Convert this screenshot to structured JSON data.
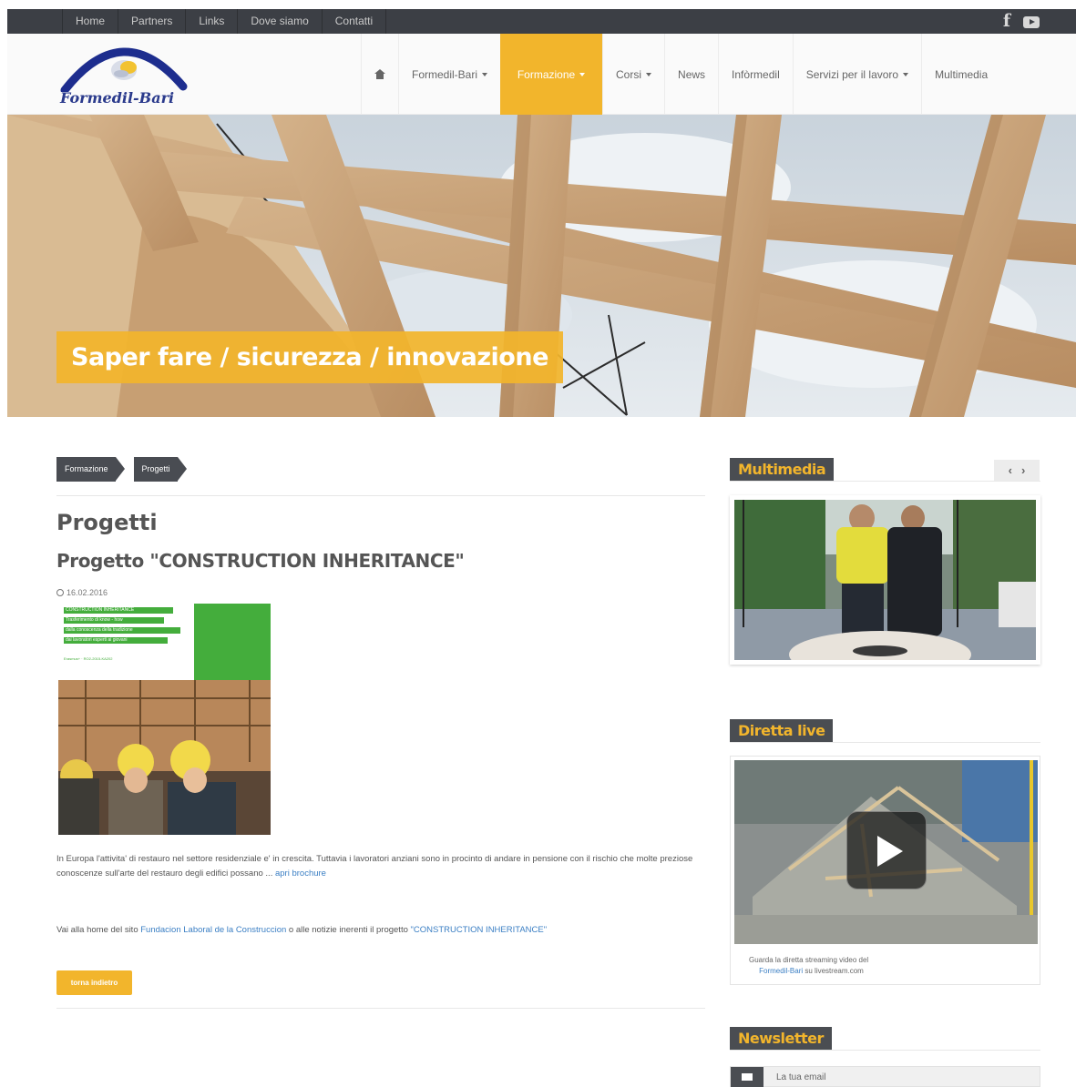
{
  "topbar": {
    "links": [
      "Home",
      "Partners",
      "Links",
      "Dove siamo",
      "Contatti"
    ],
    "social": {
      "facebook": "f",
      "youtube_icon": "youtube-icon"
    }
  },
  "header": {
    "logo_text": "Formedil-Bari",
    "nav": [
      "Formedil-Bari",
      "Formazione",
      "Corsi",
      "News",
      "Infòrmedil",
      "Servizi per il lavoro",
      "Multimedia"
    ],
    "active_nav": "Formazione"
  },
  "hero": {
    "caption": "Saper fare / sicurezza / innovazione"
  },
  "breadcrumb": [
    "Formazione",
    "Progetti"
  ],
  "main": {
    "page_title": "Progetti",
    "article_title": "Progetto \"CONSTRUCTION INHERITANCE\"",
    "date": "16.02.2016",
    "brochure": {
      "line1": "CONSTRUCTION INHERITANCE",
      "line2": "Trasferimento di know - how",
      "line3": "dalla conoscenza della tradizione",
      "line4": "dai lavoratori esperti ai giovani",
      "small": "Erasmus+ · RO2-2015-KA202"
    },
    "para1_text": "In Europa l'attivita' di restauro nel settore residenziale e' in crescita. Tuttavia i lavoratori anziani sono in procinto di andare in pensione con il rischio che molte preziose conoscenze sull'arte del restauro degli edifici possano ...",
    "para1_link": "apri brochure",
    "para2_prefix": "Vai alla home del sito",
    "para2_link1": "Fundacion Laboral de la Construccion",
    "para2_middle": "o alle notizie inerenti il progetto",
    "para2_link2": "\"CONSTRUCTION INHERITANCE\"",
    "read_more": "torna indietro"
  },
  "sidebar": {
    "multimedia_title": "Multimedia",
    "prev": "‹",
    "next": "›",
    "live_title": "Diretta live",
    "live_caption_1": "Guarda la diretta streaming video del",
    "live_caption_link": "Formedil-Bari",
    "live_caption_2": "su livestream.com",
    "newsletter_title": "Newsletter",
    "newsletter_placeholder": "La tua email"
  },
  "colors": {
    "accent": "#f2b52c",
    "dark": "#3c3f45",
    "green": "#44ad3c",
    "link": "#3b7fc4"
  }
}
